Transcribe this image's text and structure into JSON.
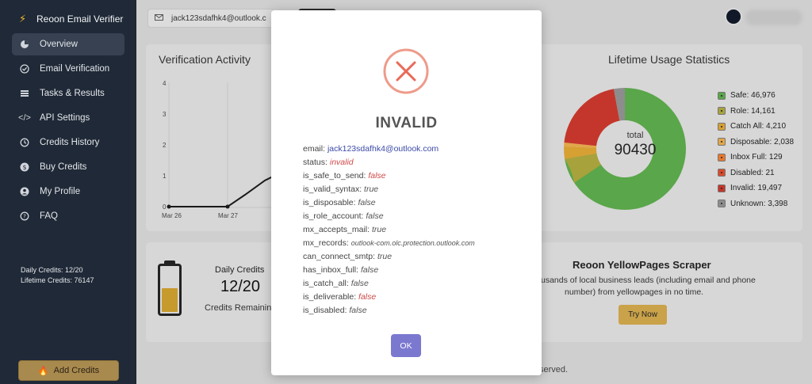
{
  "app": {
    "name": "Reoon Email Verifier"
  },
  "sidebar": {
    "items": [
      {
        "label": "Overview"
      },
      {
        "label": "Email Verification"
      },
      {
        "label": "Tasks & Results"
      },
      {
        "label": "API Settings"
      },
      {
        "label": "Credits History"
      },
      {
        "label": "Buy Credits"
      },
      {
        "label": "My Profile"
      },
      {
        "label": "FAQ"
      }
    ],
    "daily_credits": "Daily Credits: 12/20",
    "lifetime_credits": "Lifetime Credits: 76147",
    "add_credits_label": "Add Credits"
  },
  "topbar": {
    "search_value": "jack123sdafhk4@outlook.c"
  },
  "activity": {
    "title": "Verification Activity",
    "y_ticks": [
      "4",
      "3",
      "2",
      "1",
      "0"
    ],
    "x_ticks": [
      "Mar 26",
      "Mar 27"
    ]
  },
  "usage": {
    "title": "Lifetime Usage Statistics",
    "total_label": "total",
    "total_value": "90430",
    "legend": [
      {
        "label": "Safe: 46,976",
        "color": "#5aa64a"
      },
      {
        "label": "Role: 14,161",
        "color": "#a7a23c"
      },
      {
        "label": "Catch All: 4,210",
        "color": "#d6a032"
      },
      {
        "label": "Disposable: 2,038",
        "color": "#e2a64a"
      },
      {
        "label": "Inbox Full: 129",
        "color": "#e8782e"
      },
      {
        "label": "Disabled: 21",
        "color": "#d94a2c"
      },
      {
        "label": "Invalid: 19,497",
        "color": "#c4362b"
      },
      {
        "label": "Unknown: 3,398",
        "color": "#8d8d8d"
      }
    ]
  },
  "credits_card": {
    "title": "Daily Credits",
    "value": "12/20",
    "subtitle": "Credits Remainin"
  },
  "scraper": {
    "title": "Reoon YellowPages Scraper",
    "description_line1": "usands of local business leads (including email and phone",
    "description_line2": "number) from yellowpages in no time.",
    "button_label": "Try Now"
  },
  "footer": {
    "text": "served."
  },
  "modal": {
    "title": "INVALID",
    "ok_label": "OK",
    "details": [
      {
        "key": "email:",
        "value": "jack123sdafhk4@outlook.com"
      },
      {
        "key": "status:",
        "value": "invalid"
      },
      {
        "key": "is_safe_to_send:",
        "value": "false"
      },
      {
        "key": "is_valid_syntax:",
        "value": "true"
      },
      {
        "key": "is_disposable:",
        "value": "false"
      },
      {
        "key": "is_role_account:",
        "value": "false"
      },
      {
        "key": "mx_accepts_mail:",
        "value": "true"
      },
      {
        "key": "mx_records:",
        "value": "outlook-com.olc.protection.outlook.com"
      },
      {
        "key": "can_connect_smtp:",
        "value": "true"
      },
      {
        "key": "has_inbox_full:",
        "value": "false"
      },
      {
        "key": "is_catch_all:",
        "value": "false"
      },
      {
        "key": "is_deliverable:",
        "value": "false"
      },
      {
        "key": "is_disabled:",
        "value": "false"
      }
    ]
  }
}
